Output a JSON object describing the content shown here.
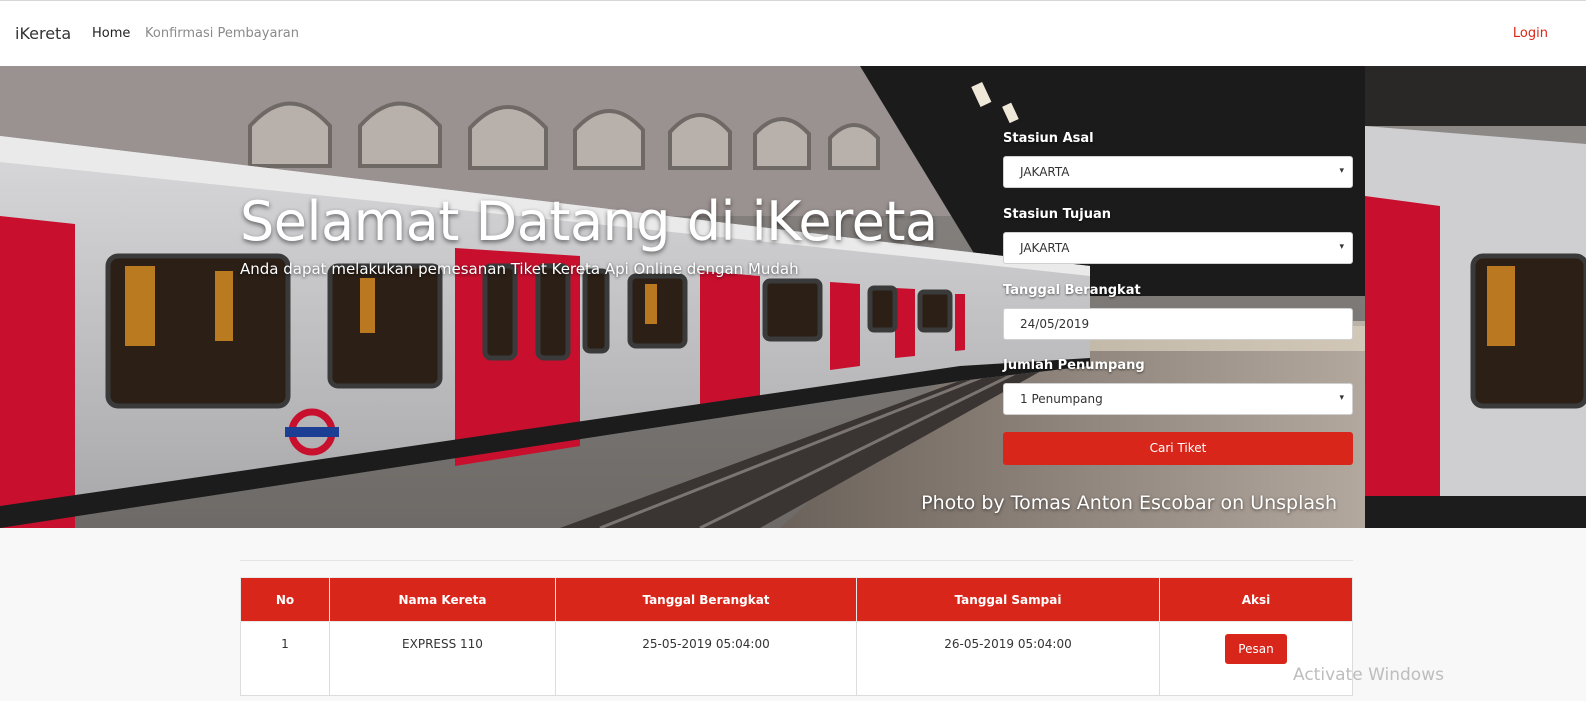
{
  "navbar": {
    "brand": "iKereta",
    "home": "Home",
    "konfirmasi": "Konfirmasi Pembayaran",
    "login": "Login"
  },
  "hero": {
    "title": "Selamat Datang di iKereta",
    "subtitle": "Anda dapat melakukan pemesanan Tiket Kereta Api Online dengan Mudah",
    "credit": "Photo by Tomas Anton Escobar on Unsplash"
  },
  "search": {
    "asal_label": "Stasiun Asal",
    "asal_value": "JAKARTA",
    "tujuan_label": "Stasiun Tujuan",
    "tujuan_value": "JAKARTA",
    "tanggal_label": "Tanggal Berangkat",
    "tanggal_value": "24/05/2019",
    "penumpang_label": "Jumlah Penumpang",
    "penumpang_value": "1 Penumpang",
    "button": "Cari Tiket"
  },
  "table": {
    "headers": [
      "No",
      "Nama Kereta",
      "Tanggal Berangkat",
      "Tanggal Sampai",
      "Aksi"
    ],
    "rows": [
      {
        "no": "1",
        "nama": "EXPRESS 110",
        "berangkat": "25-05-2019 05:04:00",
        "sampai": "26-05-2019 05:04:00",
        "aksi": "Pesan"
      }
    ]
  },
  "watermark": "Activate Windows",
  "colors": {
    "accent": "#d9261a",
    "train_red": "#c8102e",
    "nav_text": "#8a8a8a"
  },
  "icons": {
    "select_caret": "▾"
  }
}
